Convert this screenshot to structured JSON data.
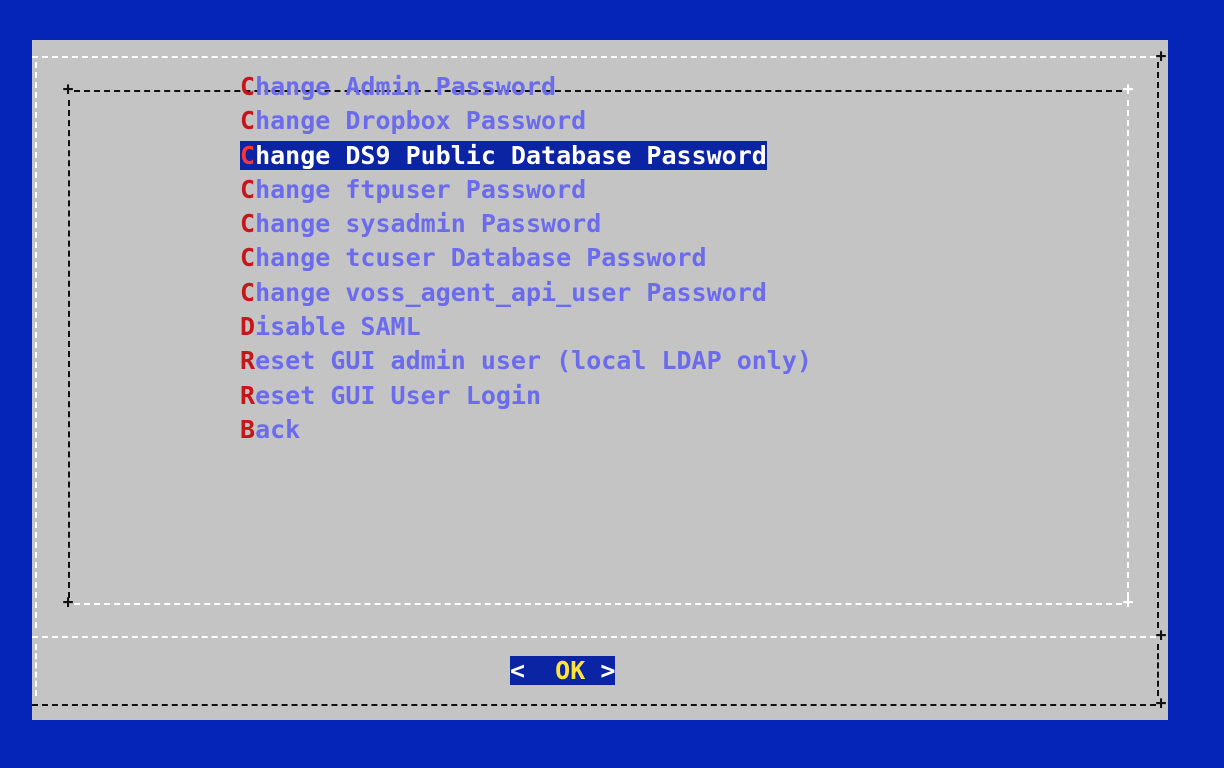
{
  "dialog": {
    "menu_items": [
      {
        "hotkey": "C",
        "rest": "hange Admin Password",
        "selected": false
      },
      {
        "hotkey": "C",
        "rest": "hange Dropbox Password",
        "selected": false
      },
      {
        "hotkey": "C",
        "rest": "hange DS9 Public Database Password",
        "selected": true
      },
      {
        "hotkey": "C",
        "rest": "hange ftpuser Password",
        "selected": false
      },
      {
        "hotkey": "C",
        "rest": "hange sysadmin Password",
        "selected": false
      },
      {
        "hotkey": "C",
        "rest": "hange tcuser Database Password",
        "selected": false
      },
      {
        "hotkey": "C",
        "rest": "hange voss_agent_api_user Password",
        "selected": false
      },
      {
        "hotkey": "D",
        "rest": "isable SAML",
        "selected": false
      },
      {
        "hotkey": "R",
        "rest": "eset GUI admin user (local LDAP only)",
        "selected": false
      },
      {
        "hotkey": "R",
        "rest": "eset GUI User Login",
        "selected": false
      },
      {
        "hotkey": "B",
        "rest": "ack",
        "selected": false
      }
    ],
    "ok_button": {
      "left_bracket": "< ",
      "pre": " ",
      "hotkey": "O",
      "rest": "K",
      "right_bracket": " >"
    }
  },
  "colors": {
    "screen_bg": "#0524b8",
    "dialog_bg": "#c4c4c4",
    "item_text": "#6b6bee",
    "hotkey": "#c6161a",
    "selection_bg": "#0b24a3"
  }
}
